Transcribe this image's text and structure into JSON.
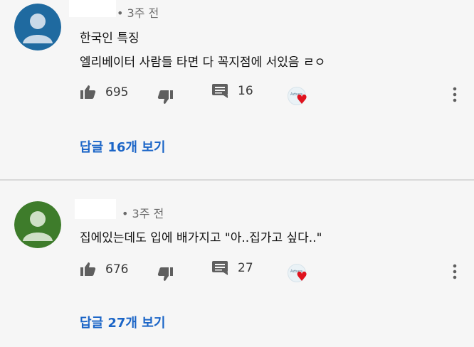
{
  "comments": [
    {
      "time": "• 3주 전",
      "lines": [
        "한국인 특징",
        "엘리베이터 사람들 타면 다 꼭지점에 서있음 ㄹㅇ"
      ],
      "likes": "695",
      "replies_count": "16",
      "view_replies": "답글 16개 보기",
      "creator_badge_text": "Azbars",
      "avatar_color": "#1f6aa0"
    },
    {
      "time": "• 3주 전",
      "lines": [
        "집에있는데도 입에 배가지고 \"아..집가고 싶다..\""
      ],
      "likes": "676",
      "replies_count": "27",
      "view_replies": "답글 27개 보기",
      "creator_badge_text": "Azbars",
      "avatar_color": "#3e7c2b"
    }
  ],
  "icons": {
    "like": "thumb-up-icon",
    "dislike": "thumb-down-icon",
    "reply": "comment-icon",
    "more": "more-vertical-icon",
    "heart": "heart-icon"
  },
  "colors": {
    "link": "#1b65c7",
    "heart": "#e0131e",
    "text_muted": "#6a6a6a",
    "background": "#f6f6f6"
  }
}
